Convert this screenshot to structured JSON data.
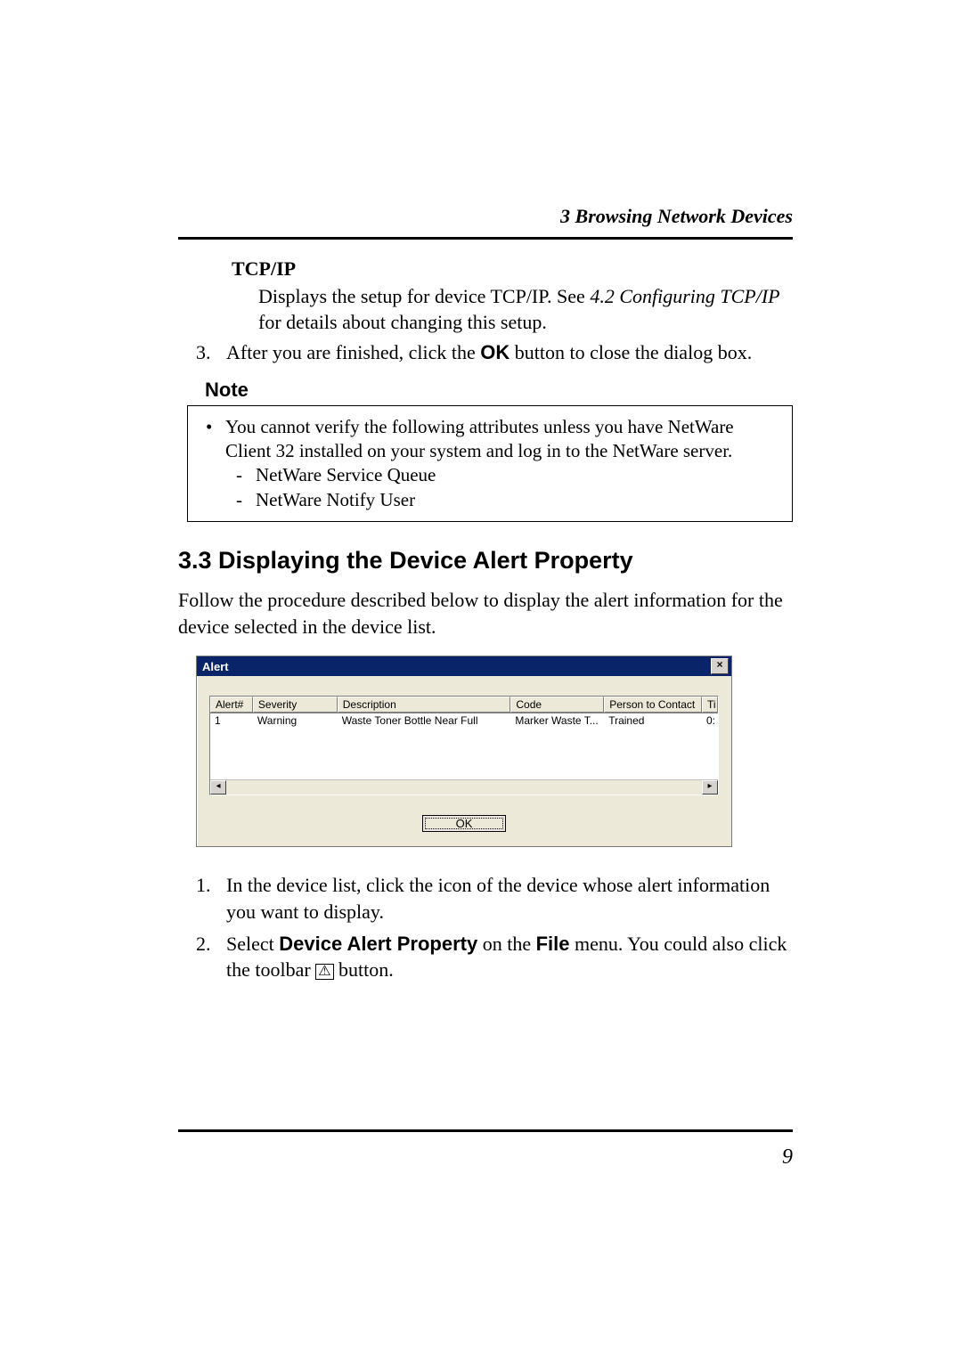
{
  "runningHead": "3  Browsing Network Devices",
  "tcpip": {
    "heading": "TCP/IP",
    "line1a": "Displays the setup for device TCP/IP. See ",
    "line1b": "4.2  Configuring TCP/IP",
    "line1c": " for details about changing this setup."
  },
  "item3": {
    "num": "3.",
    "a": "After you are finished, click the ",
    "b": "OK",
    "c": " button to close the dialog box."
  },
  "note": {
    "label": "Note",
    "bullet": "You cannot verify the following attributes unless you have NetWare Client 32 installed on your system and log in to the NetWare server.",
    "dash1": "NetWare Service Queue",
    "dash2": "NetWare Notify User"
  },
  "section": {
    "heading": "3.3   Displaying the Device Alert Property",
    "intro": "Follow the procedure described below to display the alert information for the device selected in the device list."
  },
  "dialog": {
    "title": "Alert",
    "close": "×",
    "cols": {
      "alert": "Alert#",
      "sev": "Severity",
      "desc": "Description",
      "code": "Code",
      "pers": "Person to Contact",
      "t": "Ti"
    },
    "row": {
      "alert": "1",
      "sev": "Warning",
      "desc": "Waste Toner Bottle Near Full",
      "code": "Marker Waste T...",
      "pers": "Trained",
      "t": "0:"
    },
    "left": "◂",
    "right": "▸",
    "ok": "OK"
  },
  "steps": {
    "s1n": "1.",
    "s1": "In the device list, click the icon of the device whose alert information you want to display.",
    "s2n": "2.",
    "s2a": "Select ",
    "s2b": "Device Alert Property",
    "s2c": " on the ",
    "s2d": "File",
    "s2e": " menu. You could also click the toolbar ",
    "s2icon": "⚠",
    "s2f": " button."
  },
  "chart_data": {
    "type": "table",
    "title": "Alert",
    "columns": [
      "Alert#",
      "Severity",
      "Description",
      "Code",
      "Person to Contact",
      "Ti"
    ],
    "rows": [
      [
        "1",
        "Warning",
        "Waste Toner Bottle Near Full",
        "Marker Waste T...",
        "Trained",
        "0:"
      ]
    ]
  },
  "pageNumber": "9"
}
